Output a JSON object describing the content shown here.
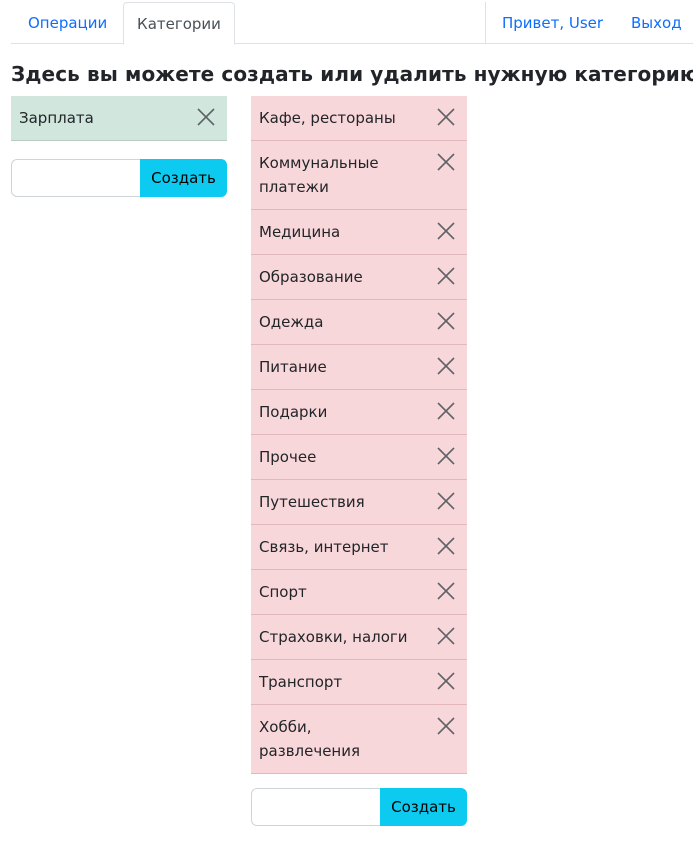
{
  "nav": {
    "tabs": [
      {
        "label": "Операции"
      },
      {
        "label": "Категории"
      }
    ],
    "greeting": "Привет, User",
    "logout": "Выход"
  },
  "page": {
    "title": "Здесь вы можете создать или удалить нужную категорию"
  },
  "income": {
    "items": [
      "Зарплата"
    ],
    "create_label": "Создать",
    "input_value": ""
  },
  "expense": {
    "items": [
      "Кафе, рестораны",
      "Коммунальные платежи",
      "Медицина",
      "Образование",
      "Одежда",
      "Питание",
      "Подарки",
      "Прочее",
      "Путешествия",
      "Связь, интернет",
      "Спорт",
      "Страховки, налоги",
      "Транспорт",
      "Хобби, развлечения"
    ],
    "create_label": "Создать",
    "input_value": ""
  },
  "colors": {
    "income_bg": "#d1e7dd",
    "expense_bg": "#f8d7da",
    "link": "#0d6efd",
    "button": "#0dcaf0"
  },
  "icons": {
    "delete": "close-icon"
  }
}
